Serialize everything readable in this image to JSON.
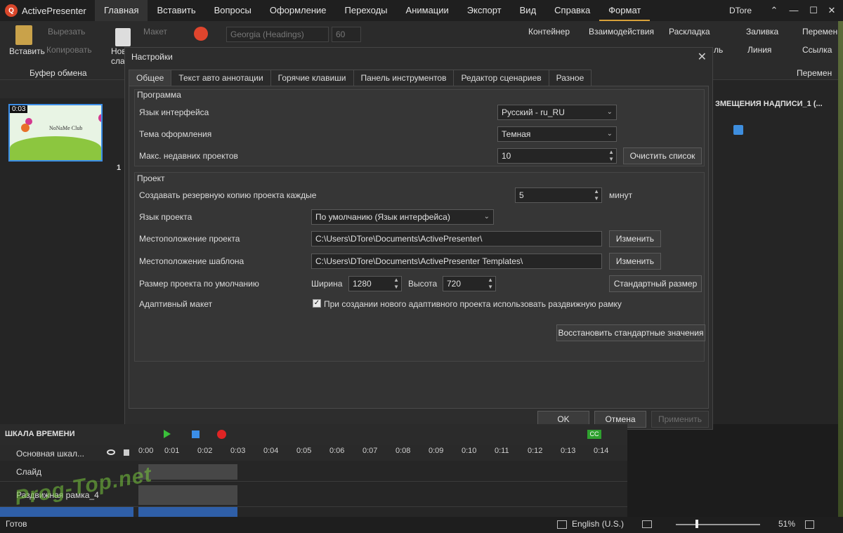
{
  "app": {
    "title": "ActivePresenter",
    "user": "DTore"
  },
  "menu": [
    "Главная",
    "Вставить",
    "Вопросы",
    "Оформление",
    "Переходы",
    "Анимации",
    "Экспорт",
    "Вид",
    "Справка",
    "Формат"
  ],
  "window_buttons": {
    "help": "⌃",
    "minimize": "—",
    "maximize": "☐",
    "close": "✕"
  },
  "ribbon": {
    "paste": "Вставить",
    "cut": "Вырезать",
    "copy": "Копировать",
    "clipboard_group": "Буфер обмена",
    "new_slide": "Нов",
    "new_slide2": "сла",
    "layout": "Макет",
    "font_name": "Georgia (Headings)",
    "font_size": "60",
    "container": "Контейнер",
    "interactions": "Взаимодействия",
    "arrange": "Раскладка",
    "fill": "Заливка",
    "line": "Линия",
    "line_prefix": "ль",
    "move": "Перемен",
    "link": "Ссылка",
    "move_group": "Перемен"
  },
  "slides_panel": {
    "duration": "0:03",
    "slide_number": "1",
    "slide_title": "NoNaMe Club"
  },
  "right_panel": {
    "title": "ЗМЕЩЕНИЯ НАДПИСИ_1 (..."
  },
  "dialog": {
    "title": "Настройки",
    "close": "✕",
    "tabs": [
      "Общее",
      "Текст авто аннотации",
      "Горячие клавиши",
      "Панель инструментов",
      "Редактор сценариев",
      "Разное"
    ],
    "program": {
      "title": "Программа",
      "ui_lang_label": "Язык интерфейса",
      "ui_lang_value": "Русский - ru_RU",
      "theme_label": "Тема оформления",
      "theme_value": "Темная",
      "recent_label": "Макс. недавних проектов",
      "recent_value": "10",
      "clear_list": "Очистить список"
    },
    "project": {
      "title": "Проект",
      "backup_label": "Создавать резервную копию проекта каждые",
      "backup_value": "5",
      "backup_unit": "минут",
      "lang_label": "Язык проекта",
      "lang_value": "По умолчанию (Язык интерфейса)",
      "location_label": "Местоположение проекта",
      "location_value": "C:\\Users\\DTore\\Documents\\ActivePresenter\\",
      "location_change": "Изменить",
      "template_label": "Местоположение шаблона",
      "template_value": "C:\\Users\\DTore\\Documents\\ActivePresenter Templates\\",
      "template_change": "Изменить",
      "size_label": "Размер проекта по умолчанию",
      "width_label": "Ширина",
      "width_value": "1280",
      "height_label": "Высота",
      "height_value": "720",
      "standard_size": "Стандартный размер",
      "adaptive_label": "Адаптивный макет",
      "adaptive_check": "При создании нового адаптивного проекта использовать раздвижную рамку"
    },
    "restore_defaults": "Восстановить стандартные значения",
    "ok": "OK",
    "cancel": "Отмена",
    "apply": "Применить"
  },
  "timeline": {
    "title": "ШКАЛА ВРЕМЕНИ",
    "main_scale": "Основная шкал...",
    "ticks": [
      "0:00",
      "0:01",
      "0:02",
      "0:03",
      "0:04",
      "0:05",
      "0:06",
      "0:07",
      "0:08",
      "0:09",
      "0:10",
      "0:11",
      "0:12",
      "0:13",
      "0:14"
    ],
    "rows": [
      "Слайд",
      "Раздвижная рамка_4"
    ]
  },
  "status": {
    "ready": "Готов",
    "language": "English (U.S.)",
    "zoom": "51%"
  },
  "watermark": "Prog-Top.net",
  "colors": {
    "accent": "#d8a23a",
    "selection": "#3c8ee8",
    "timeline_bar": "#2f5fa8",
    "logo": "#d9472b"
  }
}
